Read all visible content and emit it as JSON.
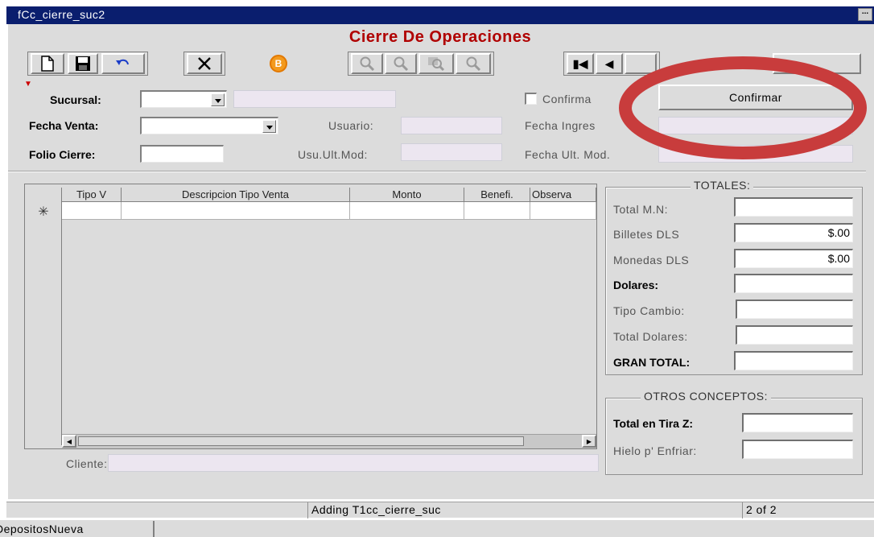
{
  "window": {
    "title": "fCc_cierre_suc2",
    "menu_glyph": "..."
  },
  "form": {
    "title": "Cierre De Operaciones"
  },
  "toolbar": {
    "new_icon": "new-document-icon",
    "save_icon": "save-icon",
    "undo_icon": "undo-icon",
    "delete_icon": "delete-x-icon",
    "b_button_label": "B",
    "nav_first": "▮◀",
    "nav_prev": "◀"
  },
  "header": {
    "sucursal_label": "Sucursal:",
    "fecha_venta_label": "Fecha Venta:",
    "folio_cierre_label": "Folio Cierre:",
    "usuario_label": "Usuario:",
    "usu_ult_mod_label": "Usu.Ult.Mod:",
    "confirma_label": "Confirma",
    "confirmar_button": "Confirmar",
    "fecha_ingreso_label": "Fecha Ingres",
    "fecha_ult_mod_label": "Fecha Ult. Mod."
  },
  "grid": {
    "columns": [
      "Tipo V",
      "Descripcion Tipo Venta",
      "Monto",
      "Benefi.",
      "Observa"
    ],
    "new_row_marker": "✳"
  },
  "totales": {
    "title": "TOTALES:",
    "rows": [
      {
        "label": "Total M.N:",
        "value": "",
        "bold": false
      },
      {
        "label": "Billetes DLS",
        "value": "$.00",
        "bold": false
      },
      {
        "label": "Monedas DLS",
        "value": "$.00",
        "bold": false
      },
      {
        "label": "Dolares:",
        "value": "",
        "bold": true
      },
      {
        "label": "Tipo Cambio:",
        "value": "",
        "bold": false
      },
      {
        "label": "Total Dolares:",
        "value": "",
        "bold": false
      },
      {
        "label": "GRAN TOTAL:",
        "value": "",
        "bold": true
      }
    ]
  },
  "otros": {
    "title": "OTROS CONCEPTOS:",
    "total_tira_label": "Total en Tira Z:",
    "hielo_label": "Hielo p' Enfriar:"
  },
  "cliente_label": "Cliente:",
  "status": {
    "mode_text": "Adding T1cc_cierre_suc",
    "record_text": "2 of 2"
  },
  "taskbar": {
    "item": "DepositosNueva"
  },
  "colors": {
    "title_red": "#b00000",
    "titlebar_blue": "#0a1e6e",
    "annotation_red": "#c83c3c"
  }
}
